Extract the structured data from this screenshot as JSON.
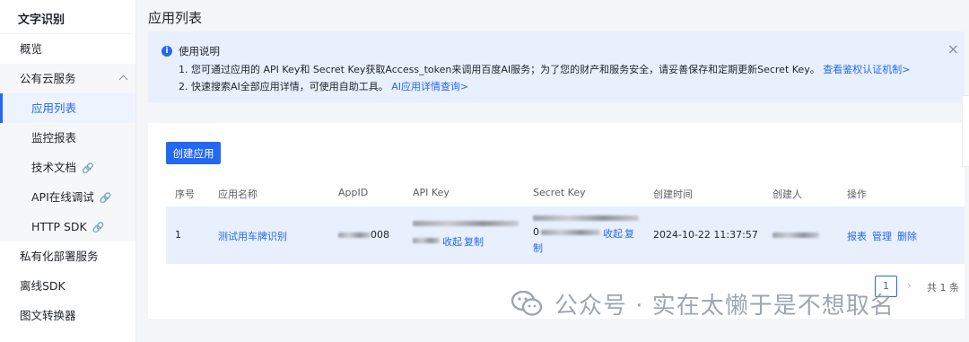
{
  "sidebar": {
    "title": "文字识别",
    "items": [
      {
        "label": "概览"
      },
      {
        "label": "公有云服务"
      },
      {
        "label": "应用列表"
      },
      {
        "label": "监控报表"
      },
      {
        "label": "技术文档"
      },
      {
        "label": "API在线调试"
      },
      {
        "label": "HTTP SDK"
      },
      {
        "label": "私有化部署服务"
      },
      {
        "label": "离线SDK"
      },
      {
        "label": "图文转换器"
      }
    ]
  },
  "page": {
    "title": "应用列表"
  },
  "notice": {
    "title": "使用说明",
    "line1_text": "1. 您可通过应用的 API Key和 Secret Key获取Access_token来调用百度AI服务；为了您的财产和服务安全，请妥善保存和定期更新Secret Key。",
    "line1_link": "查看鉴权认证机制>",
    "line2_text": "2. 快速搜索AI全部应用详情，可使用自助工具。",
    "line2_link": "AI应用详情查询>",
    "close": "×"
  },
  "toolbar": {
    "create_label": "创建应用"
  },
  "table": {
    "headers": [
      "序号",
      "应用名称",
      "AppID",
      "API Key",
      "Secret Key",
      "创建时间",
      "创建人",
      "操作"
    ],
    "rows": [
      {
        "index": "1",
        "name": "测试用车牌识别",
        "appid_tail": "008",
        "api_collapse": "收起",
        "api_copy": "复制",
        "secret_mid": "0",
        "secret_collapse": "收起",
        "secret_copy_1": "复",
        "secret_copy_2": "制",
        "created": "2024-10-22 11:37:57",
        "actions": [
          "报表",
          "管理",
          "删除"
        ]
      }
    ]
  },
  "pager": {
    "prev": "‹",
    "page": "1",
    "next": "›",
    "total": "共 1 条"
  },
  "watermark": {
    "text": "公众号 · 实在太懒于是不想取名"
  },
  "colors": {
    "accent": "#2468f2",
    "notice_bg": "#e8f0fe",
    "row_bg": "#e8f0fe"
  }
}
